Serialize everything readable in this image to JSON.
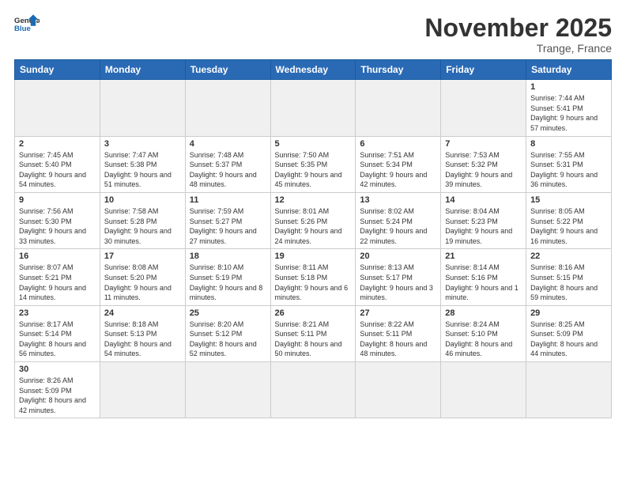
{
  "logo": {
    "general": "General",
    "blue": "Blue"
  },
  "header": {
    "month": "November 2025",
    "location": "Trange, France"
  },
  "days_of_week": [
    "Sunday",
    "Monday",
    "Tuesday",
    "Wednesday",
    "Thursday",
    "Friday",
    "Saturday"
  ],
  "weeks": [
    [
      {
        "day": "",
        "info": ""
      },
      {
        "day": "",
        "info": ""
      },
      {
        "day": "",
        "info": ""
      },
      {
        "day": "",
        "info": ""
      },
      {
        "day": "",
        "info": ""
      },
      {
        "day": "",
        "info": ""
      },
      {
        "day": "1",
        "info": "Sunrise: 7:44 AM\nSunset: 5:41 PM\nDaylight: 9 hours\nand 57 minutes."
      }
    ],
    [
      {
        "day": "2",
        "info": "Sunrise: 7:45 AM\nSunset: 5:40 PM\nDaylight: 9 hours\nand 54 minutes."
      },
      {
        "day": "3",
        "info": "Sunrise: 7:47 AM\nSunset: 5:38 PM\nDaylight: 9 hours\nand 51 minutes."
      },
      {
        "day": "4",
        "info": "Sunrise: 7:48 AM\nSunset: 5:37 PM\nDaylight: 9 hours\nand 48 minutes."
      },
      {
        "day": "5",
        "info": "Sunrise: 7:50 AM\nSunset: 5:35 PM\nDaylight: 9 hours\nand 45 minutes."
      },
      {
        "day": "6",
        "info": "Sunrise: 7:51 AM\nSunset: 5:34 PM\nDaylight: 9 hours\nand 42 minutes."
      },
      {
        "day": "7",
        "info": "Sunrise: 7:53 AM\nSunset: 5:32 PM\nDaylight: 9 hours\nand 39 minutes."
      },
      {
        "day": "8",
        "info": "Sunrise: 7:55 AM\nSunset: 5:31 PM\nDaylight: 9 hours\nand 36 minutes."
      }
    ],
    [
      {
        "day": "9",
        "info": "Sunrise: 7:56 AM\nSunset: 5:30 PM\nDaylight: 9 hours\nand 33 minutes."
      },
      {
        "day": "10",
        "info": "Sunrise: 7:58 AM\nSunset: 5:28 PM\nDaylight: 9 hours\nand 30 minutes."
      },
      {
        "day": "11",
        "info": "Sunrise: 7:59 AM\nSunset: 5:27 PM\nDaylight: 9 hours\nand 27 minutes."
      },
      {
        "day": "12",
        "info": "Sunrise: 8:01 AM\nSunset: 5:26 PM\nDaylight: 9 hours\nand 24 minutes."
      },
      {
        "day": "13",
        "info": "Sunrise: 8:02 AM\nSunset: 5:24 PM\nDaylight: 9 hours\nand 22 minutes."
      },
      {
        "day": "14",
        "info": "Sunrise: 8:04 AM\nSunset: 5:23 PM\nDaylight: 9 hours\nand 19 minutes."
      },
      {
        "day": "15",
        "info": "Sunrise: 8:05 AM\nSunset: 5:22 PM\nDaylight: 9 hours\nand 16 minutes."
      }
    ],
    [
      {
        "day": "16",
        "info": "Sunrise: 8:07 AM\nSunset: 5:21 PM\nDaylight: 9 hours\nand 14 minutes."
      },
      {
        "day": "17",
        "info": "Sunrise: 8:08 AM\nSunset: 5:20 PM\nDaylight: 9 hours\nand 11 minutes."
      },
      {
        "day": "18",
        "info": "Sunrise: 8:10 AM\nSunset: 5:19 PM\nDaylight: 9 hours\nand 8 minutes."
      },
      {
        "day": "19",
        "info": "Sunrise: 8:11 AM\nSunset: 5:18 PM\nDaylight: 9 hours\nand 6 minutes."
      },
      {
        "day": "20",
        "info": "Sunrise: 8:13 AM\nSunset: 5:17 PM\nDaylight: 9 hours\nand 3 minutes."
      },
      {
        "day": "21",
        "info": "Sunrise: 8:14 AM\nSunset: 5:16 PM\nDaylight: 9 hours\nand 1 minute."
      },
      {
        "day": "22",
        "info": "Sunrise: 8:16 AM\nSunset: 5:15 PM\nDaylight: 8 hours\nand 59 minutes."
      }
    ],
    [
      {
        "day": "23",
        "info": "Sunrise: 8:17 AM\nSunset: 5:14 PM\nDaylight: 8 hours\nand 56 minutes."
      },
      {
        "day": "24",
        "info": "Sunrise: 8:18 AM\nSunset: 5:13 PM\nDaylight: 8 hours\nand 54 minutes."
      },
      {
        "day": "25",
        "info": "Sunrise: 8:20 AM\nSunset: 5:12 PM\nDaylight: 8 hours\nand 52 minutes."
      },
      {
        "day": "26",
        "info": "Sunrise: 8:21 AM\nSunset: 5:11 PM\nDaylight: 8 hours\nand 50 minutes."
      },
      {
        "day": "27",
        "info": "Sunrise: 8:22 AM\nSunset: 5:11 PM\nDaylight: 8 hours\nand 48 minutes."
      },
      {
        "day": "28",
        "info": "Sunrise: 8:24 AM\nSunset: 5:10 PM\nDaylight: 8 hours\nand 46 minutes."
      },
      {
        "day": "29",
        "info": "Sunrise: 8:25 AM\nSunset: 5:09 PM\nDaylight: 8 hours\nand 44 minutes."
      }
    ],
    [
      {
        "day": "30",
        "info": "Sunrise: 8:26 AM\nSunset: 5:09 PM\nDaylight: 8 hours\nand 42 minutes."
      },
      {
        "day": "",
        "info": ""
      },
      {
        "day": "",
        "info": ""
      },
      {
        "day": "",
        "info": ""
      },
      {
        "day": "",
        "info": ""
      },
      {
        "day": "",
        "info": ""
      },
      {
        "day": "",
        "info": ""
      }
    ]
  ]
}
